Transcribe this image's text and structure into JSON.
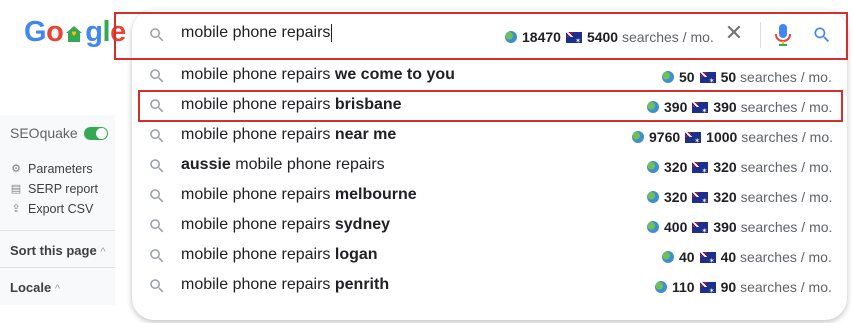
{
  "logo": {
    "letters": [
      "G",
      "o",
      "",
      "g",
      "l",
      "e"
    ]
  },
  "sidebar": {
    "seoquake_label": "SEOquake",
    "links": [
      "Parameters",
      "SERP report",
      "Export CSV"
    ],
    "sort_label": "Sort this page",
    "locale_label": "Locale"
  },
  "search": {
    "query": "mobile phone repairs",
    "global_volume": "18470",
    "au_volume": "5400",
    "unit": "searches / mo."
  },
  "suggestions": [
    {
      "prefix": "mobile phone repairs ",
      "bold": "we come to you",
      "suffix": "",
      "global": "50",
      "au": "50",
      "unit": "searches / mo."
    },
    {
      "prefix": "mobile phone repairs ",
      "bold": "brisbane",
      "suffix": "",
      "global": "390",
      "au": "390",
      "unit": "searches / mo."
    },
    {
      "prefix": "mobile phone repairs ",
      "bold": "near me",
      "suffix": "",
      "global": "9760",
      "au": "1000",
      "unit": "searches / mo."
    },
    {
      "prefix": "",
      "bold": "aussie",
      "suffix": " mobile phone repairs",
      "global": "320",
      "au": "320",
      "unit": "searches / mo."
    },
    {
      "prefix": "mobile phone repairs ",
      "bold": "melbourne",
      "suffix": "",
      "global": "320",
      "au": "320",
      "unit": "searches / mo."
    },
    {
      "prefix": "mobile phone repairs ",
      "bold": "sydney",
      "suffix": "",
      "global": "400",
      "au": "390",
      "unit": "searches / mo."
    },
    {
      "prefix": "mobile phone repairs ",
      "bold": "logan",
      "suffix": "",
      "global": "40",
      "au": "40",
      "unit": "searches / mo."
    },
    {
      "prefix": "mobile phone repairs ",
      "bold": "penrith",
      "suffix": "",
      "global": "110",
      "au": "90",
      "unit": "searches / mo."
    }
  ],
  "colors": {
    "highlight": "#d32f2f",
    "toggle": "#34a853"
  }
}
